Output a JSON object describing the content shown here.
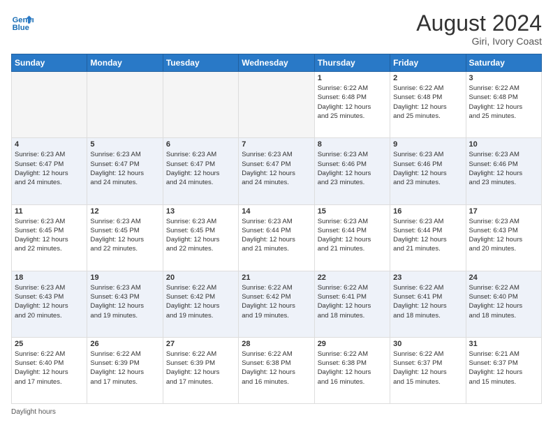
{
  "header": {
    "logo_line1": "General",
    "logo_line2": "Blue",
    "month_year": "August 2024",
    "location": "Giri, Ivory Coast"
  },
  "days_of_week": [
    "Sunday",
    "Monday",
    "Tuesday",
    "Wednesday",
    "Thursday",
    "Friday",
    "Saturday"
  ],
  "weeks": [
    [
      {
        "day": "",
        "info": ""
      },
      {
        "day": "",
        "info": ""
      },
      {
        "day": "",
        "info": ""
      },
      {
        "day": "",
        "info": ""
      },
      {
        "day": "1",
        "info": "Sunrise: 6:22 AM\nSunset: 6:48 PM\nDaylight: 12 hours\nand 25 minutes."
      },
      {
        "day": "2",
        "info": "Sunrise: 6:22 AM\nSunset: 6:48 PM\nDaylight: 12 hours\nand 25 minutes."
      },
      {
        "day": "3",
        "info": "Sunrise: 6:22 AM\nSunset: 6:48 PM\nDaylight: 12 hours\nand 25 minutes."
      }
    ],
    [
      {
        "day": "4",
        "info": "Sunrise: 6:23 AM\nSunset: 6:47 PM\nDaylight: 12 hours\nand 24 minutes."
      },
      {
        "day": "5",
        "info": "Sunrise: 6:23 AM\nSunset: 6:47 PM\nDaylight: 12 hours\nand 24 minutes."
      },
      {
        "day": "6",
        "info": "Sunrise: 6:23 AM\nSunset: 6:47 PM\nDaylight: 12 hours\nand 24 minutes."
      },
      {
        "day": "7",
        "info": "Sunrise: 6:23 AM\nSunset: 6:47 PM\nDaylight: 12 hours\nand 24 minutes."
      },
      {
        "day": "8",
        "info": "Sunrise: 6:23 AM\nSunset: 6:46 PM\nDaylight: 12 hours\nand 23 minutes."
      },
      {
        "day": "9",
        "info": "Sunrise: 6:23 AM\nSunset: 6:46 PM\nDaylight: 12 hours\nand 23 minutes."
      },
      {
        "day": "10",
        "info": "Sunrise: 6:23 AM\nSunset: 6:46 PM\nDaylight: 12 hours\nand 23 minutes."
      }
    ],
    [
      {
        "day": "11",
        "info": "Sunrise: 6:23 AM\nSunset: 6:45 PM\nDaylight: 12 hours\nand 22 minutes."
      },
      {
        "day": "12",
        "info": "Sunrise: 6:23 AM\nSunset: 6:45 PM\nDaylight: 12 hours\nand 22 minutes."
      },
      {
        "day": "13",
        "info": "Sunrise: 6:23 AM\nSunset: 6:45 PM\nDaylight: 12 hours\nand 22 minutes."
      },
      {
        "day": "14",
        "info": "Sunrise: 6:23 AM\nSunset: 6:44 PM\nDaylight: 12 hours\nand 21 minutes."
      },
      {
        "day": "15",
        "info": "Sunrise: 6:23 AM\nSunset: 6:44 PM\nDaylight: 12 hours\nand 21 minutes."
      },
      {
        "day": "16",
        "info": "Sunrise: 6:23 AM\nSunset: 6:44 PM\nDaylight: 12 hours\nand 21 minutes."
      },
      {
        "day": "17",
        "info": "Sunrise: 6:23 AM\nSunset: 6:43 PM\nDaylight: 12 hours\nand 20 minutes."
      }
    ],
    [
      {
        "day": "18",
        "info": "Sunrise: 6:23 AM\nSunset: 6:43 PM\nDaylight: 12 hours\nand 20 minutes."
      },
      {
        "day": "19",
        "info": "Sunrise: 6:23 AM\nSunset: 6:43 PM\nDaylight: 12 hours\nand 19 minutes."
      },
      {
        "day": "20",
        "info": "Sunrise: 6:22 AM\nSunset: 6:42 PM\nDaylight: 12 hours\nand 19 minutes."
      },
      {
        "day": "21",
        "info": "Sunrise: 6:22 AM\nSunset: 6:42 PM\nDaylight: 12 hours\nand 19 minutes."
      },
      {
        "day": "22",
        "info": "Sunrise: 6:22 AM\nSunset: 6:41 PM\nDaylight: 12 hours\nand 18 minutes."
      },
      {
        "day": "23",
        "info": "Sunrise: 6:22 AM\nSunset: 6:41 PM\nDaylight: 12 hours\nand 18 minutes."
      },
      {
        "day": "24",
        "info": "Sunrise: 6:22 AM\nSunset: 6:40 PM\nDaylight: 12 hours\nand 18 minutes."
      }
    ],
    [
      {
        "day": "25",
        "info": "Sunrise: 6:22 AM\nSunset: 6:40 PM\nDaylight: 12 hours\nand 17 minutes."
      },
      {
        "day": "26",
        "info": "Sunrise: 6:22 AM\nSunset: 6:39 PM\nDaylight: 12 hours\nand 17 minutes."
      },
      {
        "day": "27",
        "info": "Sunrise: 6:22 AM\nSunset: 6:39 PM\nDaylight: 12 hours\nand 17 minutes."
      },
      {
        "day": "28",
        "info": "Sunrise: 6:22 AM\nSunset: 6:38 PM\nDaylight: 12 hours\nand 16 minutes."
      },
      {
        "day": "29",
        "info": "Sunrise: 6:22 AM\nSunset: 6:38 PM\nDaylight: 12 hours\nand 16 minutes."
      },
      {
        "day": "30",
        "info": "Sunrise: 6:22 AM\nSunset: 6:37 PM\nDaylight: 12 hours\nand 15 minutes."
      },
      {
        "day": "31",
        "info": "Sunrise: 6:21 AM\nSunset: 6:37 PM\nDaylight: 12 hours\nand 15 minutes."
      }
    ]
  ],
  "footer": {
    "daylight_label": "Daylight hours"
  }
}
